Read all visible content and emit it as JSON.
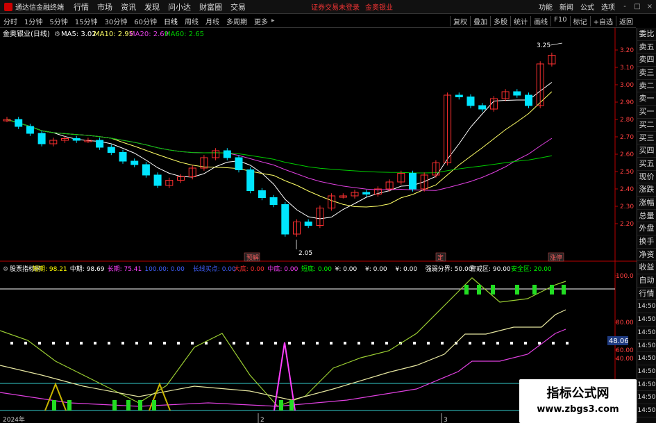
{
  "app": {
    "title": "通达信金融终端",
    "menus": [
      "行情",
      "市场",
      "资讯",
      "发现",
      "问小达",
      "财富圈",
      "交易"
    ],
    "notice": "证券交易未登录",
    "notice2": "金奥银业",
    "right_menus": [
      "功能",
      "新闻",
      "公式",
      "选项"
    ],
    "window_buttons": [
      "-",
      "□",
      "×"
    ]
  },
  "toolbar": {
    "timeframes": [
      "分时",
      "1分钟",
      "5分钟",
      "15分钟",
      "30分钟",
      "60分钟",
      "日线",
      "周线",
      "月线",
      "多周期",
      "更多"
    ],
    "active": "日线",
    "buttons": [
      "复权",
      "叠加",
      "多股",
      "统计",
      "画线",
      "F10",
      "标记",
      "+自选",
      "返回"
    ]
  },
  "main_chart": {
    "legend": {
      "stock": "金奥银业(日线)",
      "ma5": "MA5: 3.02",
      "ma10": "MA10: 2.95",
      "ma20": "MA20: 2.69",
      "ma60": "MA60: 2.65"
    },
    "price_ticks": [
      "3.20",
      "3.10",
      "3.00",
      "2.90",
      "2.80",
      "2.70",
      "2.60",
      "2.50",
      "2.40",
      "2.30",
      "2.20"
    ],
    "high_label": "3.25",
    "low_label": "2.05",
    "markers": [
      {
        "text": "预解"
      },
      {
        "text": "定"
      },
      {
        "text": "涨停"
      }
    ],
    "colors": {
      "up": "#ff3030",
      "down": "#00e5ff",
      "ma5": "#ffffff",
      "ma10": "#ffff66",
      "ma20": "#e040e0",
      "ma60": "#00cc00"
    }
  },
  "indicator": {
    "legend": [
      {
        "text": "股票指标网",
        "color": "#ffffff"
      },
      {
        "text": "短期: 98.21",
        "color": "#ffff00"
      },
      {
        "text": "中期: 98.69",
        "color": "#ffffff"
      },
      {
        "text": "长期: 75.41",
        "color": "#ff40ff"
      },
      {
        "text": "100.00: 0.00",
        "color": "#4060ff"
      },
      {
        "text": "长线买点: 0.00",
        "color": "#4060ff"
      },
      {
        "text": "大底: 0.00",
        "color": "#ff3030"
      },
      {
        "text": "中底: 0.00",
        "color": "#ff40ff"
      },
      {
        "text": "短底: 0.00",
        "color": "#00ff00"
      },
      {
        "text": "¥: 0.00",
        "color": "#ffffff"
      },
      {
        "text": "¥: 0.00",
        "color": "#ffffff"
      },
      {
        "text": "¥: 0.00",
        "color": "#ffffff"
      },
      {
        "text": "强弱分界: 50.00",
        "color": "#ffffff"
      },
      {
        "text": "警戒区: 90.00",
        "color": "#ffffff"
      },
      {
        "text": "安全区: 20.00",
        "color": "#00ff00"
      }
    ],
    "axis_ticks": [
      "100.0",
      "80.00",
      "60.00",
      "40.00"
    ],
    "current_value": "48.06",
    "date_labels": [
      "2024年",
      "2",
      "3"
    ]
  },
  "sidebar": [
    "委比",
    "卖五",
    "卖四",
    "卖三",
    "卖二",
    "卖一",
    "买一",
    "买二",
    "买三",
    "买四",
    "买五",
    "现价",
    "涨跌",
    "涨幅",
    "总量",
    "外盘",
    "换手",
    "净资",
    "收益",
    "自动",
    "行情",
    "14:50",
    "14:50",
    "14:50",
    "14:50",
    "14:50",
    "14:50",
    "14:50",
    "14:50",
    "14:50"
  ],
  "watermark": {
    "title": "指标公式网",
    "url": "www.zbgs3.com"
  }
}
